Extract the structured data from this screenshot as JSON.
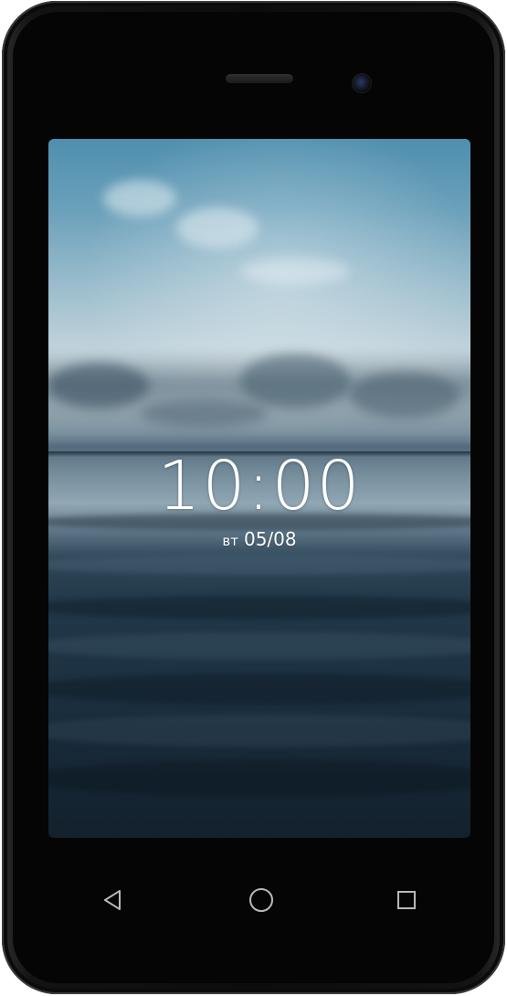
{
  "lockscreen": {
    "time": "10:00",
    "day": "вт",
    "date": "05/08"
  },
  "navigation": {
    "back_icon": "back-triangle-icon",
    "home_icon": "home-circle-icon",
    "recent_icon": "recent-apps-square-icon"
  },
  "colors": {
    "bezel": "#0c0c0d",
    "text": "#ffffff",
    "nav_icon": "#b9b9b9"
  }
}
